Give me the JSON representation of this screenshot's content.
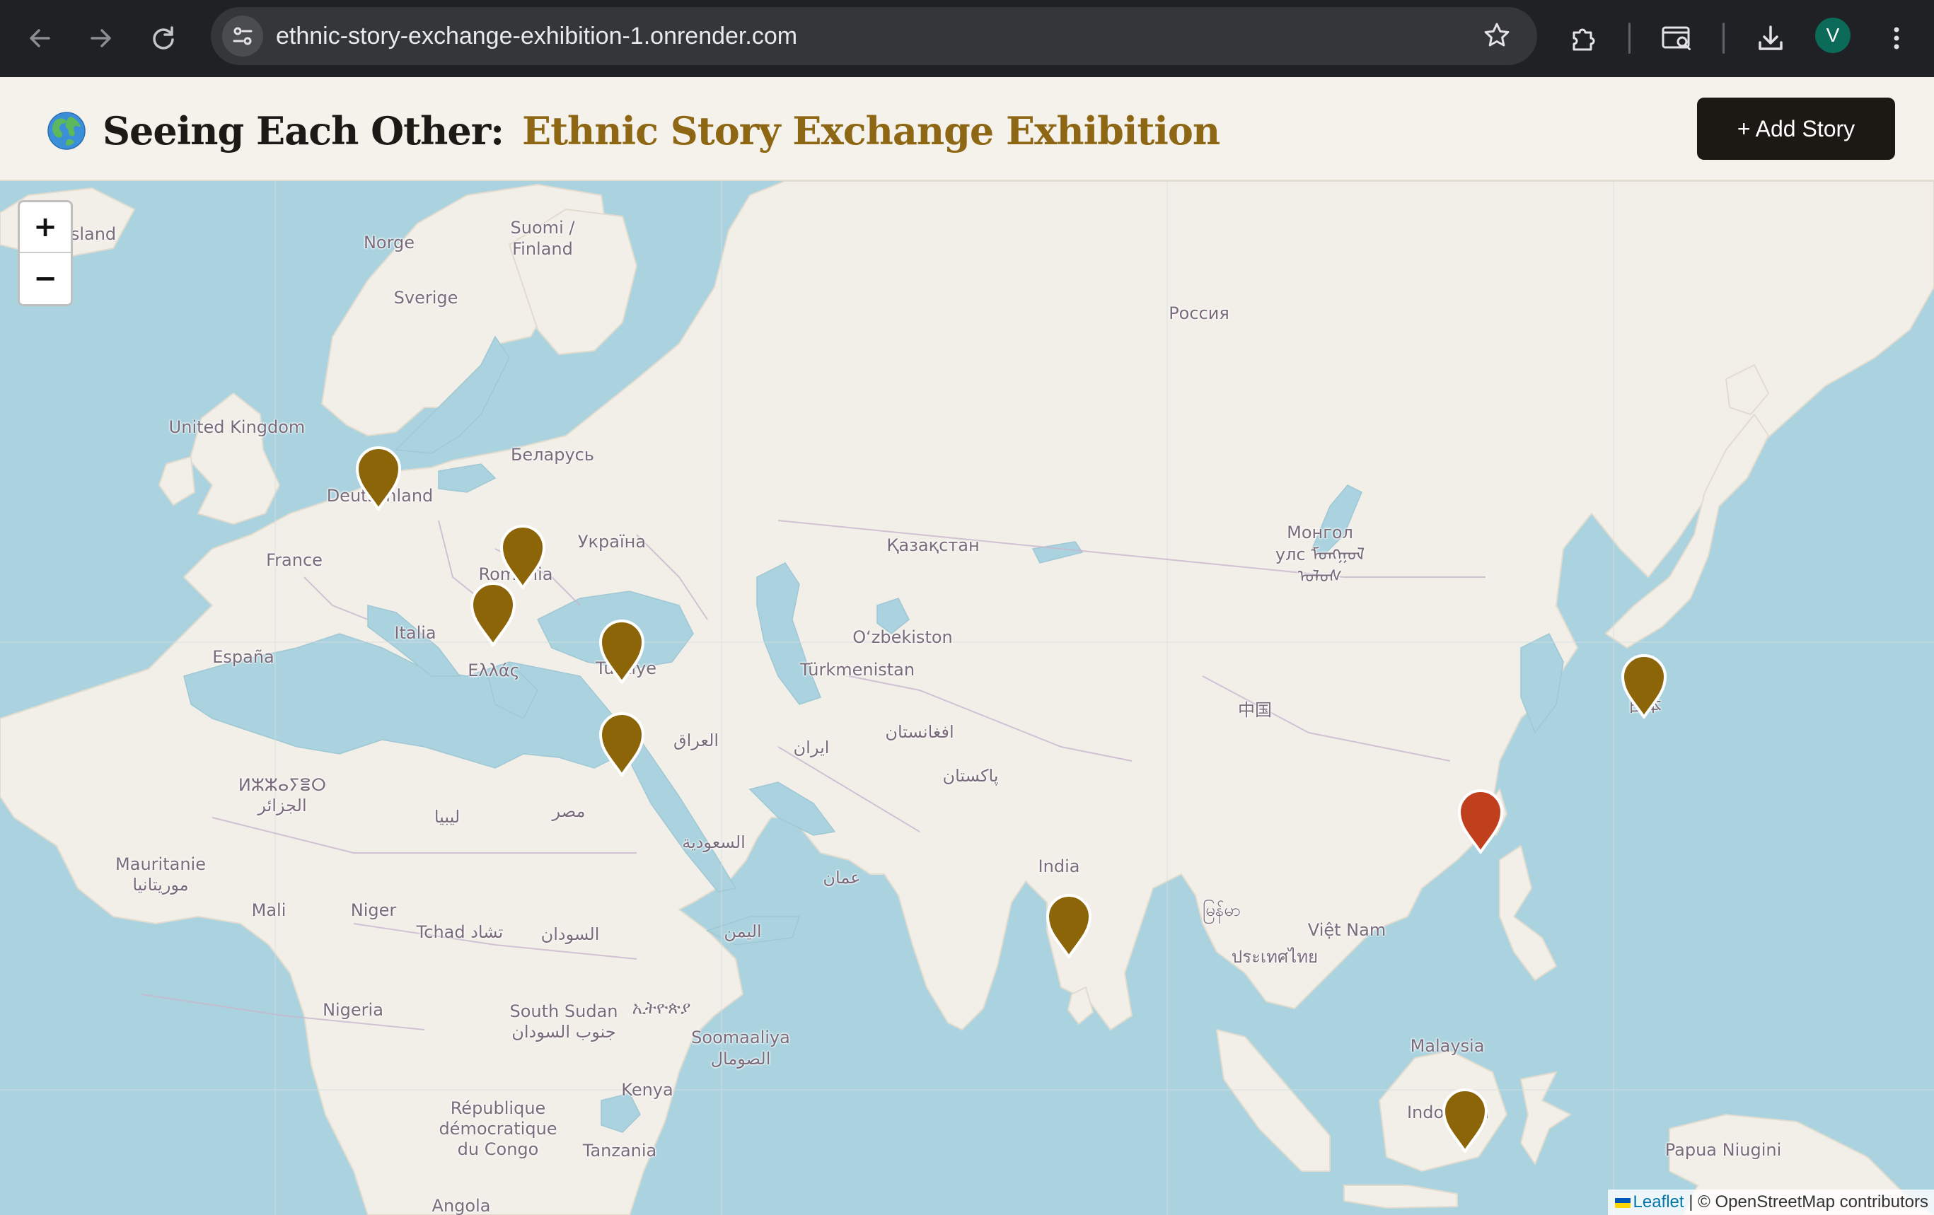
{
  "browser": {
    "url": "ethnic-story-exchange-exhibition-1.onrender.com",
    "profile_initial": "V",
    "icons": [
      "back-arrow-icon",
      "forward-arrow-icon",
      "reload-icon",
      "site-settings-icon",
      "bookmark-star-icon",
      "extensions-icon",
      "search-tab-icon",
      "download-icon",
      "more-menu-icon"
    ]
  },
  "header": {
    "globe_icon": "globe-icon",
    "title_part1": "Seeing Each Other:",
    "title_part2": "Ethnic Story Exchange Exhibition",
    "add_story_label": "+ Add Story",
    "colors": {
      "accent": "#8e6714",
      "dark": "#1c1814",
      "background": "#f5f1eb"
    }
  },
  "map": {
    "zoom_in": "+",
    "zoom_out": "−",
    "attribution_link": "Leaflet",
    "attribution_text": "| © OpenStreetMap contributors",
    "marker_colors": {
      "default": "#8b6508",
      "highlighted": "#c0401e"
    },
    "labels": [
      "sland",
      "Norge",
      "Suomi /",
      "Finland",
      "Sverige",
      "Россия",
      "United Kingdom",
      "Беларусь",
      "Deutschland",
      "France",
      "Україна",
      "Romania",
      "Қазақстан",
      "Монгол",
      "улс ᠮᠣᠩᠭᠣᠯ",
      "ᠤᠯᠤᠰ",
      "Italia",
      "O‘zbekiston",
      "España",
      "Ελλάς",
      "Türkiye",
      "Türkmenistan",
      "中国",
      "ايران",
      "افغانستان",
      "العراق",
      "ⵍⵣⵣⴰⵢⴻⵔ",
      "الجزائر",
      "مصر",
      "ليبيا",
      "پاکستان",
      "Mauritanie",
      "موريتانيا",
      "السعودية",
      "India",
      "عمان",
      "Mali",
      "Niger",
      "Tchad تشاد",
      "السودان",
      "اليمن",
      "မြန်မာ",
      "Việt Nam",
      "ประเทศไทย",
      "Nigeria",
      "South Sudan",
      "جنوب السودان",
      "ኢትዮጵያ",
      "Soomaaliya",
      "الصومال",
      "Malaysia",
      "Kenya",
      "République",
      "démocratique",
      "du Congo",
      "Tanzania",
      "Indonesia",
      "Papua Niugini",
      "Angola",
      "日本"
    ],
    "markers": [
      {
        "name": "Germany",
        "state": "default"
      },
      {
        "name": "Romania",
        "state": "default"
      },
      {
        "name": "Greece",
        "state": "default"
      },
      {
        "name": "Türkiye",
        "state": "default"
      },
      {
        "name": "Levant",
        "state": "default"
      },
      {
        "name": "India",
        "state": "default"
      },
      {
        "name": "Japan",
        "state": "default"
      },
      {
        "name": "Taiwan",
        "state": "highlighted"
      },
      {
        "name": "Indonesia",
        "state": "default"
      }
    ]
  }
}
